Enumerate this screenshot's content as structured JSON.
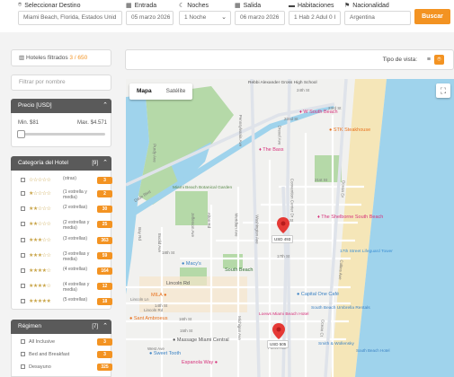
{
  "search": {
    "destination": {
      "label": "Seleccionar Destino",
      "value": "Miami Beach, Florida, Estados Unid"
    },
    "checkin": {
      "label": "Entrada",
      "value": "05 marzo 2026"
    },
    "nights": {
      "label": "Noches",
      "value": "1 Noche"
    },
    "checkout": {
      "label": "Salida",
      "value": "06 marzo 2026"
    },
    "rooms": {
      "label": "Habitaciones",
      "value": "1 Hab 2 Adul 0 I"
    },
    "nationality": {
      "label": "Nacionalidad",
      "value": "Argentina"
    },
    "button": "Buscar"
  },
  "sidebar": {
    "filtered_label": "Hoteles filtrados",
    "filtered_count": "3 / 650",
    "name_filter_placeholder": "Filtrar por nombre",
    "price": {
      "title": "Precio [USD]",
      "min": "Min. $81",
      "max": "Max. $4.571",
      "range": [
        0,
        0.05
      ]
    },
    "category": {
      "title": "Categoría del Hotel",
      "count": "[9]",
      "items": [
        {
          "stars": "☆☆☆☆☆",
          "label": "(otras)",
          "count": "3"
        },
        {
          "stars": "★☆☆☆☆",
          "label": "(1 estrella y media)",
          "count": "2"
        },
        {
          "stars": "★★☆☆☆",
          "label": "(2 estrellas)",
          "count": "30"
        },
        {
          "stars": "★★☆☆☆",
          "label": "(2 estrellas y media)",
          "count": "25"
        },
        {
          "stars": "★★★☆☆",
          "label": "(3 estrellas)",
          "count": "363"
        },
        {
          "stars": "★★★☆☆",
          "label": "(3 estrellas y media)",
          "count": "59"
        },
        {
          "stars": "★★★★☆",
          "label": "(4 estrellas)",
          "count": "164"
        },
        {
          "stars": "★★★★☆",
          "label": "(4 estrellas y media)",
          "count": "12"
        },
        {
          "stars": "★★★★★",
          "label": "(5 estrellas)",
          "count": "18"
        }
      ]
    },
    "regimen": {
      "title": "Régimen",
      "count": "[7]",
      "items": [
        {
          "label": "All Inclusive",
          "count": "3"
        },
        {
          "label": "Bed and Breakfast",
          "count": "3"
        },
        {
          "label": "Desayuno",
          "count": "325"
        }
      ]
    }
  },
  "map_header": {
    "view_label": "Tipo de vista:",
    "list_icon": "list-icon",
    "map_icon": "map-pin-icon"
  },
  "map": {
    "type_map": "Mapa",
    "type_satellite": "Satélite",
    "fullscreen_icon": "fullscreen-icon",
    "places": [
      {
        "name": "Rebbi Alexander Gross High School"
      },
      {
        "name": "W South Beach"
      },
      {
        "name": "STK Steakhouse"
      },
      {
        "name": "The Bass"
      },
      {
        "name": "Miami Beach Botanical Garden"
      },
      {
        "name": "The Shelborne South Beach"
      },
      {
        "name": "17th Street Lifeguard Tower"
      },
      {
        "name": "Macy's"
      },
      {
        "name": "South Beach"
      },
      {
        "name": "Lincoln Rd"
      },
      {
        "name": "MILA"
      },
      {
        "name": "Capital One Café"
      },
      {
        "name": "Loews Miami Beach Hotel"
      },
      {
        "name": "South Beach Umbrella Rentals"
      },
      {
        "name": "Sant Ambroeus"
      },
      {
        "name": "Smith & Wollensky"
      },
      {
        "name": "Massage Miami Central"
      },
      {
        "name": "Sweet Tooth"
      },
      {
        "name": "Espanola Way"
      },
      {
        "name": "Dade Blvd"
      },
      {
        "name": "Alton Rd"
      },
      {
        "name": "Meridian Ave"
      },
      {
        "name": "Washington Ave"
      },
      {
        "name": "Collins Ave"
      },
      {
        "name": "Convention Center Dr"
      },
      {
        "name": "20th St"
      },
      {
        "name": "17th St"
      },
      {
        "name": "16th St"
      },
      {
        "name": "15th St"
      },
      {
        "name": "14th St"
      },
      {
        "name": "Michigan Ave"
      },
      {
        "name": "Jefferson Ave"
      },
      {
        "name": "Euclid Ave"
      },
      {
        "name": "Pennsylvania Ave"
      },
      {
        "name": "Drexel Ave"
      },
      {
        "name": "24th St"
      },
      {
        "name": "22nd St"
      },
      {
        "name": "Purdy Ave"
      },
      {
        "name": "Bay Rd"
      },
      {
        "name": "Lincoln Ln"
      },
      {
        "name": "Ocean Dr"
      },
      {
        "name": "West Ave"
      },
      {
        "name": "Pierre Ave"
      },
      {
        "name": "South Beach Hotel"
      },
      {
        "name": "Lincoln Rd"
      },
      {
        "name": "Ocean Ct"
      },
      {
        "name": "18th St"
      },
      {
        "name": "21st St"
      },
      {
        "name": "23rd St"
      }
    ],
    "markers": [
      {
        "price": "USD 493"
      },
      {
        "price": "USD 505"
      }
    ],
    "colors": {
      "water": "#9fd3ec",
      "park": "#b5d9a8",
      "beach": "#f5e6b8",
      "marker": "#e53935",
      "accent": "#f39322"
    }
  }
}
